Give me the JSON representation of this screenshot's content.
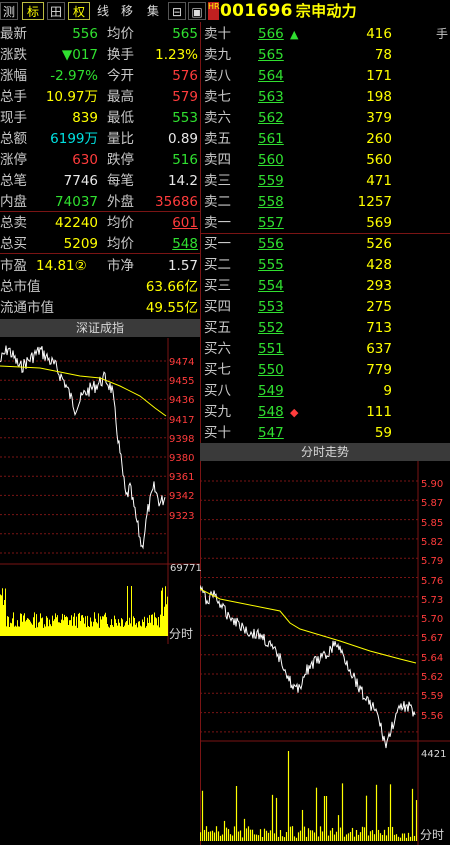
{
  "toolbar": {
    "buttons": [
      "测",
      "标",
      "田",
      "权",
      "线",
      "移",
      "集",
      "⊟",
      "▣"
    ],
    "hr_badge": "HR",
    "stock_code": "001696",
    "stock_name": "宗申动力"
  },
  "left_quote": [
    {
      "l1": "最新",
      "v1": "556",
      "c1": "green",
      "l2": "均价",
      "v2": "565",
      "c2": "green"
    },
    {
      "l1": "涨跌",
      "v1": "▼017",
      "c1": "green",
      "l2": "换手",
      "v2": "1.23%",
      "c2": "yellow"
    },
    {
      "l1": "涨幅",
      "v1": "-2.97%",
      "c1": "green",
      "l2": "今开",
      "v2": "576",
      "c2": "red"
    },
    {
      "l1": "总手",
      "v1": "10.97万",
      "c1": "yellow",
      "l2": "最高",
      "v2": "579",
      "c2": "red"
    },
    {
      "l1": "现手",
      "v1": "839",
      "c1": "yellow",
      "l2": "最低",
      "v2": "553",
      "c2": "green"
    },
    {
      "l1": "总额",
      "v1": "6199万",
      "c1": "cyan",
      "l2": "量比",
      "v2": "0.89",
      "c2": "white"
    },
    {
      "l1": "涨停",
      "v1": "630",
      "c1": "red",
      "l2": "跌停",
      "v2": "516",
      "c2": "green"
    },
    {
      "l1": "总笔",
      "v1": "7746",
      "c1": "white",
      "l2": "每笔",
      "v2": "14.2",
      "c2": "white"
    },
    {
      "l1": "内盘",
      "v1": "74037",
      "c1": "green",
      "l2": "外盘",
      "v2": "35686",
      "c2": "red"
    },
    {
      "l1": "总卖",
      "v1": "42240",
      "c1": "yellow",
      "l2": "均价",
      "v2": "601",
      "c2": "red"
    },
    {
      "l1": "总买",
      "v1": "5209",
      "c1": "yellow",
      "l2": "均价",
      "v2": "548",
      "c2": "green"
    }
  ],
  "valuation": {
    "pe_label": "市盈",
    "pe_value": "14.81②",
    "pb_label": "市净",
    "pb_value": "1.57",
    "mcap_label": "总市值",
    "mcap_value": "63.66亿",
    "float_label": "流通市值",
    "float_value": "49.55亿"
  },
  "order_book": {
    "hand_label": "手",
    "asks": [
      {
        "label": "卖十",
        "price": "566",
        "vol": "416",
        "marker": "▲"
      },
      {
        "label": "卖九",
        "price": "565",
        "vol": "78",
        "marker": ""
      },
      {
        "label": "卖八",
        "price": "564",
        "vol": "171",
        "marker": ""
      },
      {
        "label": "卖七",
        "price": "563",
        "vol": "198",
        "marker": ""
      },
      {
        "label": "卖六",
        "price": "562",
        "vol": "379",
        "marker": ""
      },
      {
        "label": "卖五",
        "price": "561",
        "vol": "260",
        "marker": ""
      },
      {
        "label": "卖四",
        "price": "560",
        "vol": "560",
        "marker": ""
      },
      {
        "label": "卖三",
        "price": "559",
        "vol": "471",
        "marker": ""
      },
      {
        "label": "卖二",
        "price": "558",
        "vol": "1257",
        "marker": ""
      },
      {
        "label": "卖一",
        "price": "557",
        "vol": "569",
        "marker": ""
      }
    ],
    "bids": [
      {
        "label": "买一",
        "price": "556",
        "vol": "526",
        "marker": ""
      },
      {
        "label": "买二",
        "price": "555",
        "vol": "428",
        "marker": ""
      },
      {
        "label": "买三",
        "price": "554",
        "vol": "293",
        "marker": ""
      },
      {
        "label": "买四",
        "price": "553",
        "vol": "275",
        "marker": ""
      },
      {
        "label": "买五",
        "price": "552",
        "vol": "713",
        "marker": ""
      },
      {
        "label": "买六",
        "price": "551",
        "vol": "637",
        "marker": ""
      },
      {
        "label": "买七",
        "price": "550",
        "vol": "779",
        "marker": ""
      },
      {
        "label": "买八",
        "price": "549",
        "vol": "9",
        "marker": ""
      },
      {
        "label": "买九",
        "price": "548",
        "vol": "111",
        "marker": "◆"
      },
      {
        "label": "买十",
        "price": "547",
        "vol": "59",
        "marker": ""
      }
    ]
  },
  "index_panel": {
    "title": "深证成指",
    "price_ticks": [
      "9474",
      "9455",
      "9436",
      "9417",
      "9398",
      "9380",
      "9361",
      "9342",
      "9323"
    ],
    "volume_tick": "69771",
    "time_label": "分时"
  },
  "stock_panel": {
    "title": "分时走势",
    "price_ticks": [
      "5.90",
      "5.87",
      "5.85",
      "5.82",
      "5.79",
      "5.76",
      "5.73",
      "5.70",
      "5.67",
      "5.64",
      "5.62",
      "5.59",
      "5.56"
    ],
    "volume_tick": "4421",
    "time_label": "分时"
  },
  "colors": {
    "up": "#ff3c3c",
    "down": "#30e030",
    "volume": "#ffff00",
    "price_line": "#ffffff",
    "avg_line": "#ffff00",
    "grid": "#7a1414"
  }
}
